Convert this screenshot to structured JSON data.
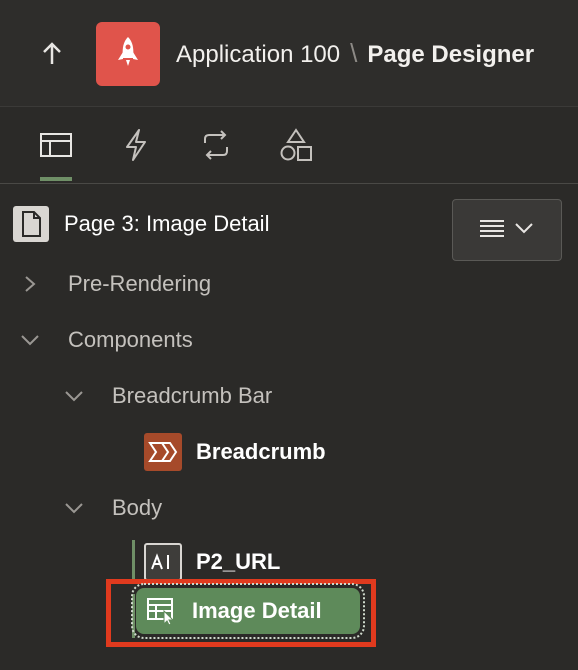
{
  "header": {
    "app_name": "Application 100",
    "separator": "\\",
    "page_name": "Page Designer",
    "icons": [
      "up-arrow-icon",
      "rocket-icon"
    ],
    "logo_color": "#e0544b"
  },
  "tabs": [
    {
      "name": "rendering",
      "icon": "rendering-icon",
      "active": true
    },
    {
      "name": "dynamic-actions",
      "icon": "lightning-icon",
      "active": false
    },
    {
      "name": "processing",
      "icon": "processing-icon",
      "active": false
    },
    {
      "name": "shared-components",
      "icon": "shapes-icon",
      "active": false
    }
  ],
  "tree": {
    "page_title": "Page 3: Image Detail",
    "items": {
      "pre_rendering": "Pre-Rendering",
      "components": "Components",
      "breadcrumb_bar": "Breadcrumb Bar",
      "breadcrumb": "Breadcrumb",
      "body": "Body",
      "p2_url": "P2_URL",
      "image_detail": "Image Detail"
    }
  },
  "colors": {
    "accent_green": "#6f8f67",
    "selected_bg": "#5e8a5a",
    "highlight_red": "#e03a1e",
    "breadcrumb_icon": "#a64a2a"
  }
}
